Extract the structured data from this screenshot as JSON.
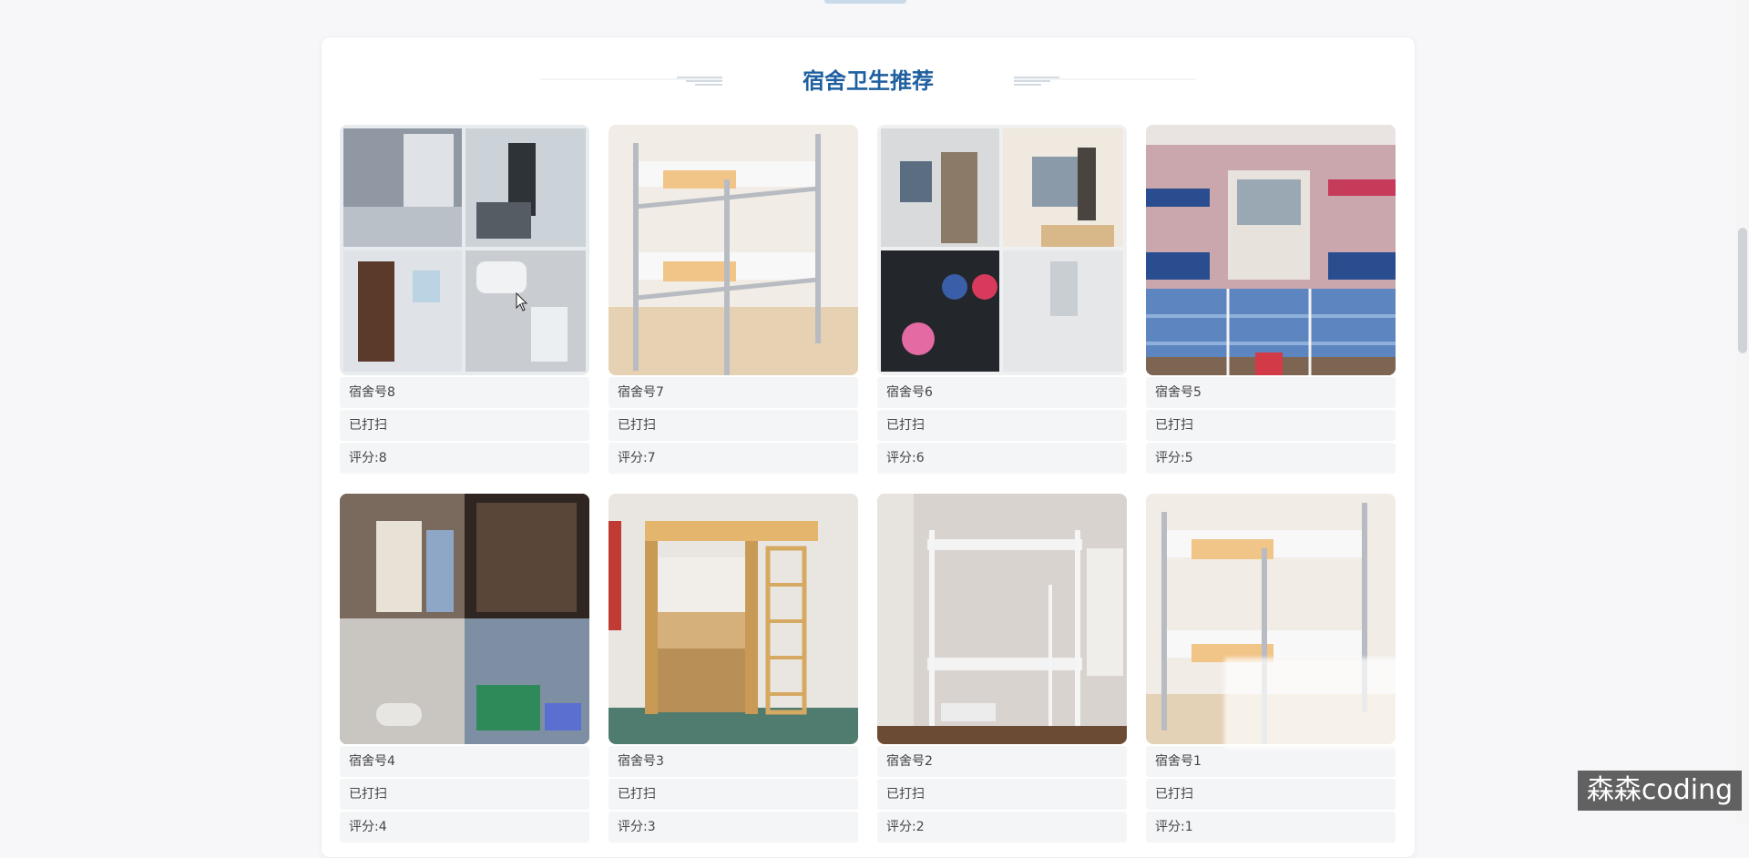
{
  "section": {
    "title": "宿舍卫生推荐"
  },
  "dorms": [
    {
      "room": "宿舍号8",
      "status": "已打扫",
      "score": "评分:8",
      "image": "dorm-collage-image"
    },
    {
      "room": "宿舍号7",
      "status": "已打扫",
      "score": "评分:7",
      "image": "bunk-bed-image"
    },
    {
      "room": "宿舍号6",
      "status": "已打扫",
      "score": "评分:6",
      "image": "dorm-collage-image"
    },
    {
      "room": "宿舍号5",
      "status": "已打扫",
      "score": "评分:5",
      "image": "dorm-room-image"
    },
    {
      "room": "宿舍号4",
      "status": "已打扫",
      "score": "评分:4",
      "image": "dorm-collage-image"
    },
    {
      "room": "宿舍号3",
      "status": "已打扫",
      "score": "评分:3",
      "image": "loft-bed-image"
    },
    {
      "room": "宿舍号2",
      "status": "已打扫",
      "score": "评分:2",
      "image": "bunk-bed-image"
    },
    {
      "room": "宿舍号1",
      "status": "已打扫",
      "score": "评分:1",
      "image": "bunk-bed-image"
    }
  ],
  "watermark": {
    "text": "森森coding"
  },
  "colors": {
    "title": "#1f5fa0",
    "panel": "#ffffff",
    "info_bg": "#f4f5f7"
  }
}
